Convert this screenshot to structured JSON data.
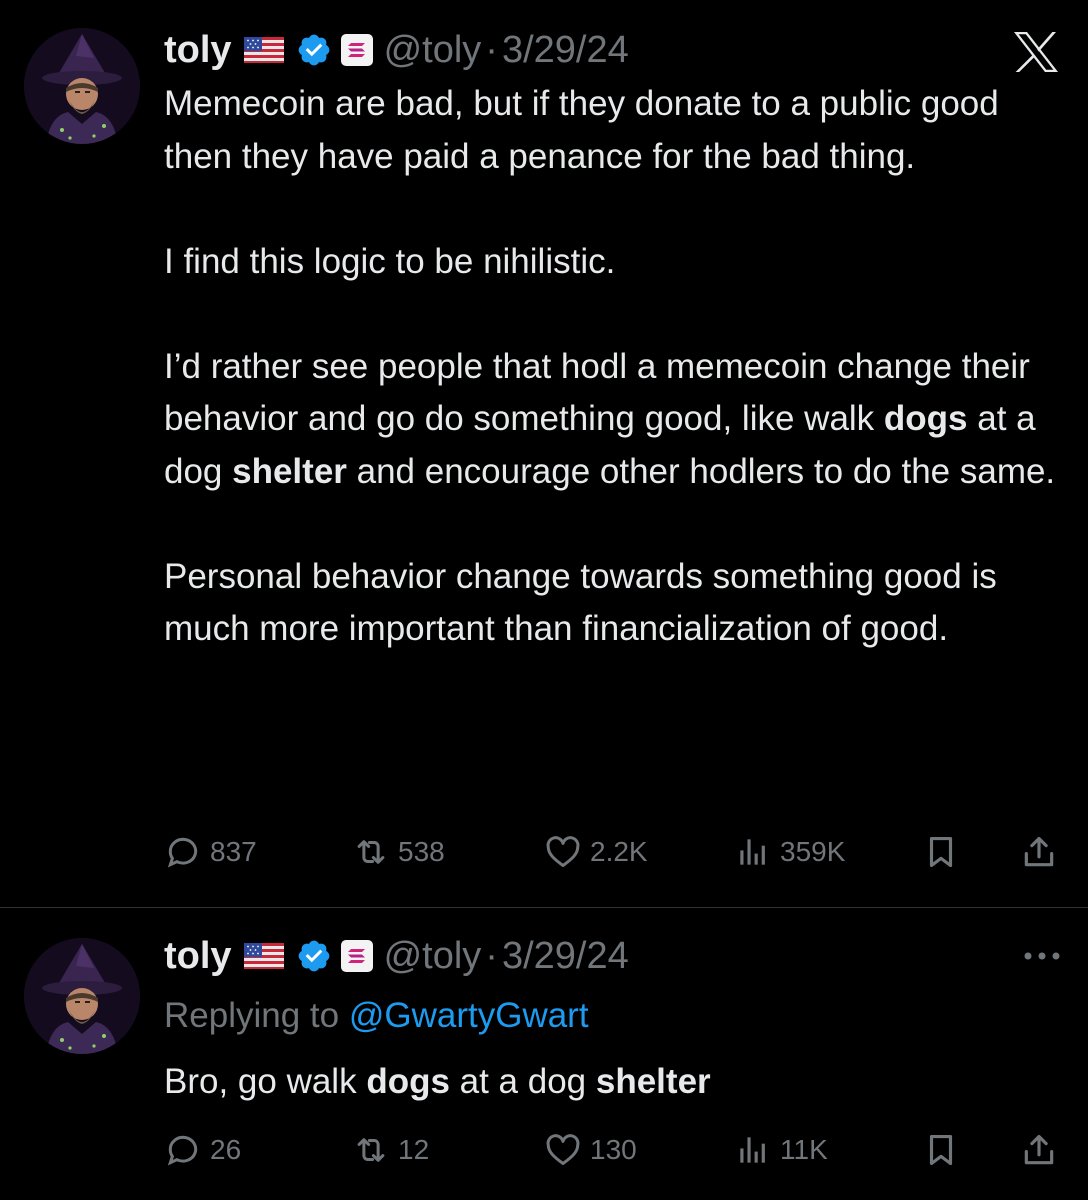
{
  "brand": {
    "logo": "x-logo",
    "accent": "#1d9bf0",
    "background": "#000000"
  },
  "tweets": [
    {
      "author": {
        "name": "toly",
        "flag": "us-flag",
        "verified": true,
        "affiliate": "solana-badge",
        "handle": "@toly",
        "avatar": "wizard-avatar"
      },
      "separator": "·",
      "date": "3/29/24",
      "paragraphs": [
        "Memecoin are bad, but if they donate to a public good then they have paid a penance for the bad thing.",
        "I find this logic to be nihilistic.",
        "I’d rather see people that hodl a memecoin change their behavior and go do something good, like walk dogs at a dog shelter and encourage other hodlers to do the same.",
        "Personal behavior change towards something good is much more important than financialization of good."
      ],
      "p3": {
        "a": "I’d rather see people that hodl a memecoin change their behavior and go do something good, like walk ",
        "b": "dogs",
        "c": " at a dog ",
        "d": "shelter",
        "e": " and encourage other hodlers to do the same."
      },
      "stats": {
        "replies": "837",
        "reposts": "538",
        "likes": "2.2K",
        "views": "359K"
      }
    },
    {
      "author": {
        "name": "toly",
        "flag": "us-flag",
        "verified": true,
        "affiliate": "solana-badge",
        "handle": "@toly",
        "avatar": "wizard-avatar"
      },
      "separator": "·",
      "date": "3/29/24",
      "replying_prefix": "Replying to",
      "replying_to": "@GwartyGwart",
      "text": {
        "a": "Bro, go walk ",
        "b": "dogs",
        "c": " at a dog ",
        "d": "shelter"
      },
      "stats": {
        "replies": "26",
        "reposts": "12",
        "likes": "130",
        "views": "11K"
      }
    }
  ]
}
